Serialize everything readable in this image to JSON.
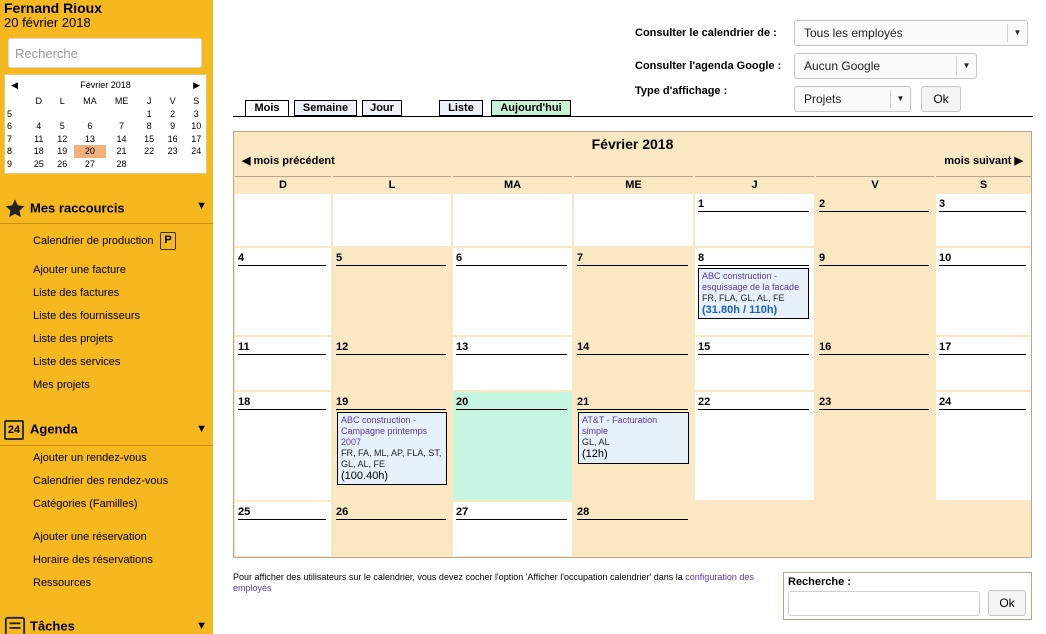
{
  "user": {
    "name": "Fernand Rioux",
    "date": "20 février 2018"
  },
  "sidebar": {
    "search_placeholder": "Recherche",
    "mini_calendar": {
      "month": "Février 2018",
      "weekdays": [
        "D",
        "L",
        "MA",
        "ME",
        "J",
        "V",
        "S"
      ],
      "weeks": [
        {
          "num": "5",
          "days": [
            "",
            "",
            "",
            "",
            "1",
            "2",
            "3"
          ]
        },
        {
          "num": "6",
          "days": [
            "4",
            "5",
            "6",
            "7",
            "8",
            "9",
            "10"
          ]
        },
        {
          "num": "7",
          "days": [
            "11",
            "12",
            "13",
            "14",
            "15",
            "16",
            "17"
          ]
        },
        {
          "num": "8",
          "days": [
            "18",
            "19",
            "20",
            "21",
            "22",
            "23",
            "24"
          ]
        },
        {
          "num": "9",
          "days": [
            "25",
            "26",
            "27",
            "28",
            "",
            "",
            ""
          ]
        }
      ]
    },
    "shortcuts": {
      "title": "Mes raccourcis",
      "items": [
        "Calendrier de production",
        "Ajouter une facture",
        "Liste des factures",
        "Liste des fournisseurs",
        "Liste des projets",
        "Liste des services",
        "Mes projets"
      ],
      "badge": "P"
    },
    "agenda": {
      "title": "Agenda",
      "icon_text": "24",
      "items": [
        "Ajouter un rendez-vous",
        "Calendrier des rendez-vous",
        "Catégories (Familles)",
        "Ajouter une réservation",
        "Horaire des réservations",
        "Ressources"
      ]
    },
    "tasks": {
      "title": "Tâches"
    }
  },
  "controls": {
    "calendar_of_label": "Consulter le calendrier de :",
    "calendar_of_value": "Tous les employés",
    "google_label": "Consulter l'agenda Google :",
    "google_value": "Aucun Google",
    "display_label": "Type d'affichage :",
    "display_value": "Projets",
    "ok": "Ok"
  },
  "tabs": [
    "Mois",
    "Semaine",
    "Jour",
    "Liste",
    "Aujourd'hui"
  ],
  "calendar": {
    "title": "Février 2018",
    "prev": "mois précédent",
    "next": "mois suivant",
    "day_headers": [
      "D",
      "L",
      "MA",
      "ME",
      "J",
      "V",
      "S"
    ],
    "weeks": [
      [
        "",
        "",
        "",
        "",
        "1",
        "2",
        "3"
      ],
      [
        "4",
        "5",
        "6",
        "7",
        "8",
        "9",
        "10"
      ],
      [
        "11",
        "12",
        "13",
        "14",
        "15",
        "16",
        "17"
      ],
      [
        "18",
        "19",
        "20",
        "21",
        "22",
        "23",
        "24"
      ],
      [
        "25",
        "26",
        "27",
        "28",
        "",
        "",
        ""
      ]
    ],
    "events": {
      "e8": {
        "title": "ABC construction - esquissage de la facade",
        "staff": "FR, FLA, GL, AL, FE",
        "hours": "(31.80h / 110h)"
      },
      "e19": {
        "title": "ABC construction - Campagne printemps 2007",
        "staff": "FR, FA, ML, AP, FLA, ST, GL, AL, FE",
        "hours": "(100.40h)"
      },
      "e21": {
        "title": "AT&T - Facturation simple",
        "staff": "GL, AL",
        "hours": "(12h)"
      }
    }
  },
  "footer": {
    "note_text": "Pour afficher des utilisateurs sur le calendrier, vous devez cocher l'option 'Afficher l'occupation calendrier' dans la ",
    "note_link": "configuration des employés",
    "search_label": "Recherche :",
    "ok": "Ok"
  }
}
